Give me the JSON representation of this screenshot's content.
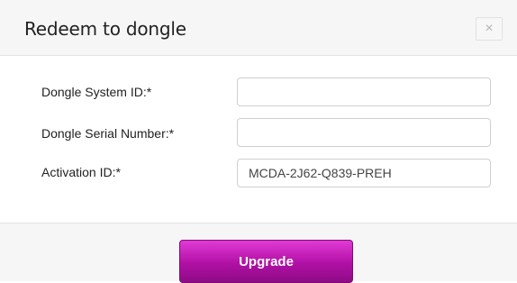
{
  "dialog": {
    "title": "Redeem to dongle",
    "close_glyph": "×",
    "close_icon": "close-icon"
  },
  "form": {
    "fields": [
      {
        "label": "Dongle System ID:*",
        "value": "",
        "placeholder": ""
      },
      {
        "label": "Dongle Serial Number:*",
        "value": "",
        "placeholder": ""
      },
      {
        "label": "Activation ID:*",
        "value": "MCDA-2J62-Q839-PREH",
        "placeholder": ""
      }
    ]
  },
  "footer": {
    "upgrade_label": "Upgrade"
  },
  "colors": {
    "primary_button": "#b010a4",
    "header_bg": "#f6f6f6"
  }
}
